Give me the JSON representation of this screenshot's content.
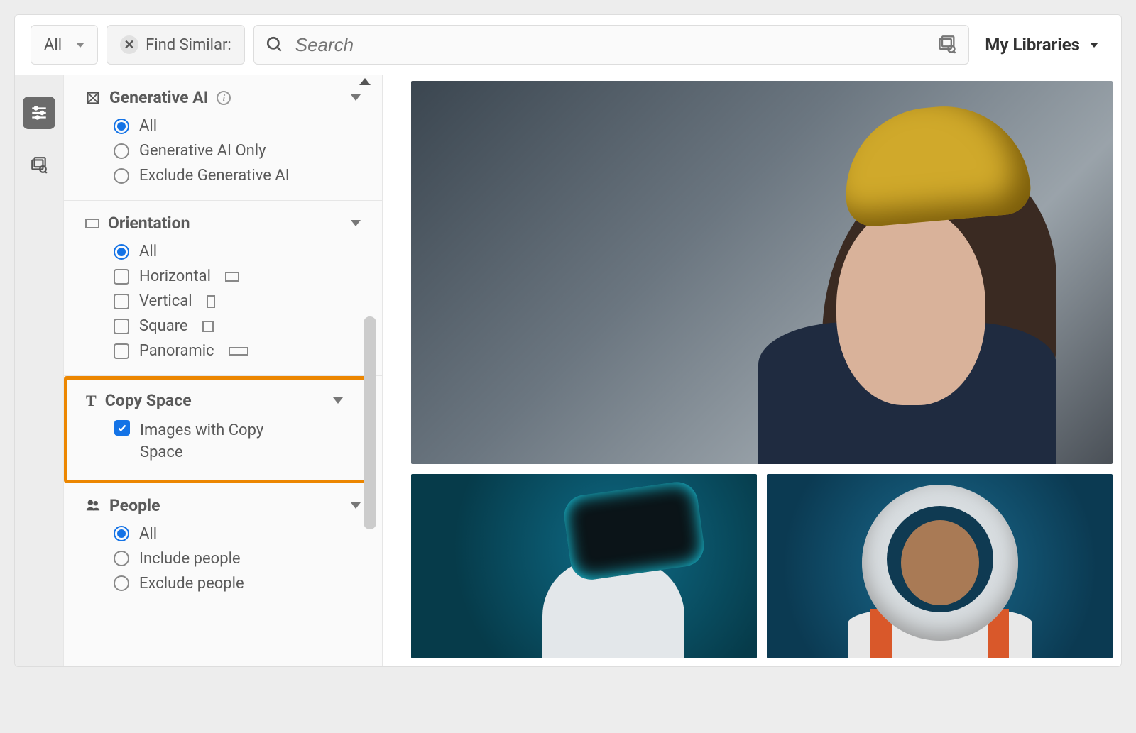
{
  "topbar": {
    "dropdown_label": "All",
    "find_similar_label": "Find Similar:",
    "search_placeholder": "Search",
    "my_libraries_label": "My Libraries"
  },
  "filters": {
    "gen_ai": {
      "title": "Generative AI",
      "options": {
        "all": "All",
        "only": "Generative AI Only",
        "exclude": "Exclude Generative AI"
      },
      "selected": "all"
    },
    "orientation": {
      "title": "Orientation",
      "options": {
        "all": "All",
        "horizontal": "Horizontal",
        "vertical": "Vertical",
        "square": "Square",
        "panoramic": "Panoramic"
      },
      "selected": "all"
    },
    "copy_space": {
      "title": "Copy Space",
      "checkbox_label": "Images with Copy Space",
      "checked": true
    },
    "people": {
      "title": "People",
      "options": {
        "all": "All",
        "include": "Include people",
        "exclude": "Exclude people"
      },
      "selected": "all"
    }
  }
}
